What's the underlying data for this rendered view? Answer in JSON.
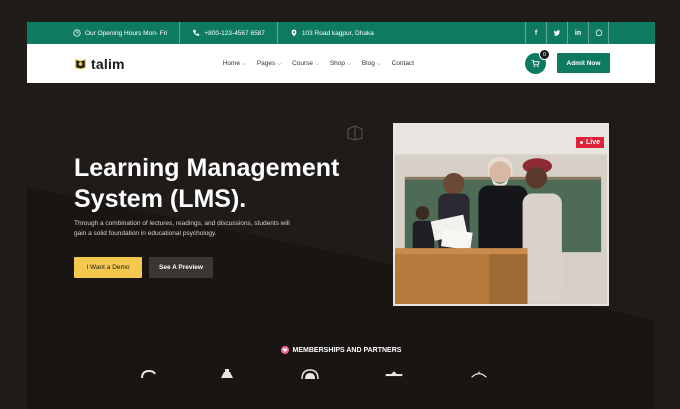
{
  "topbar": {
    "hours": "Our Opening Hours Mon- Fri",
    "phone": "+800-123-4567 6587",
    "address": "103 Road kagpur, Dhaka",
    "socials": [
      "f",
      "t",
      "in",
      "w"
    ],
    "social_icons": [
      "facebook-icon",
      "twitter-icon",
      "linkedin-icon",
      "whatsapp-icon"
    ]
  },
  "nav": {
    "logo_text": "talim",
    "menu": [
      {
        "label": "Home",
        "dropdown": true
      },
      {
        "label": "Pages",
        "dropdown": true
      },
      {
        "label": "Course",
        "dropdown": true
      },
      {
        "label": "Shop",
        "dropdown": true
      },
      {
        "label": "Blog",
        "dropdown": true
      },
      {
        "label": "Contact",
        "dropdown": false
      }
    ],
    "cart_count": "0",
    "cta_label": "Admit Now"
  },
  "hero": {
    "title_line1": "Learning Management",
    "title_line2": "System (LMS).",
    "subtitle_line1": "Through a combination of lectures, readings, and discussions, students will",
    "subtitle_line2": "gain a solid foundation in educational psychology.",
    "primary_button": "I Want a Demo",
    "secondary_button": "See A Preview",
    "live_badge": "Live"
  },
  "partners": {
    "title": "MEMBERSHIPS AND PARTNERS"
  },
  "colors": {
    "brand_green": "#0f7a62",
    "accent_yellow": "#f4c74f",
    "live_red": "#e0213a",
    "background": "#1c1917"
  }
}
